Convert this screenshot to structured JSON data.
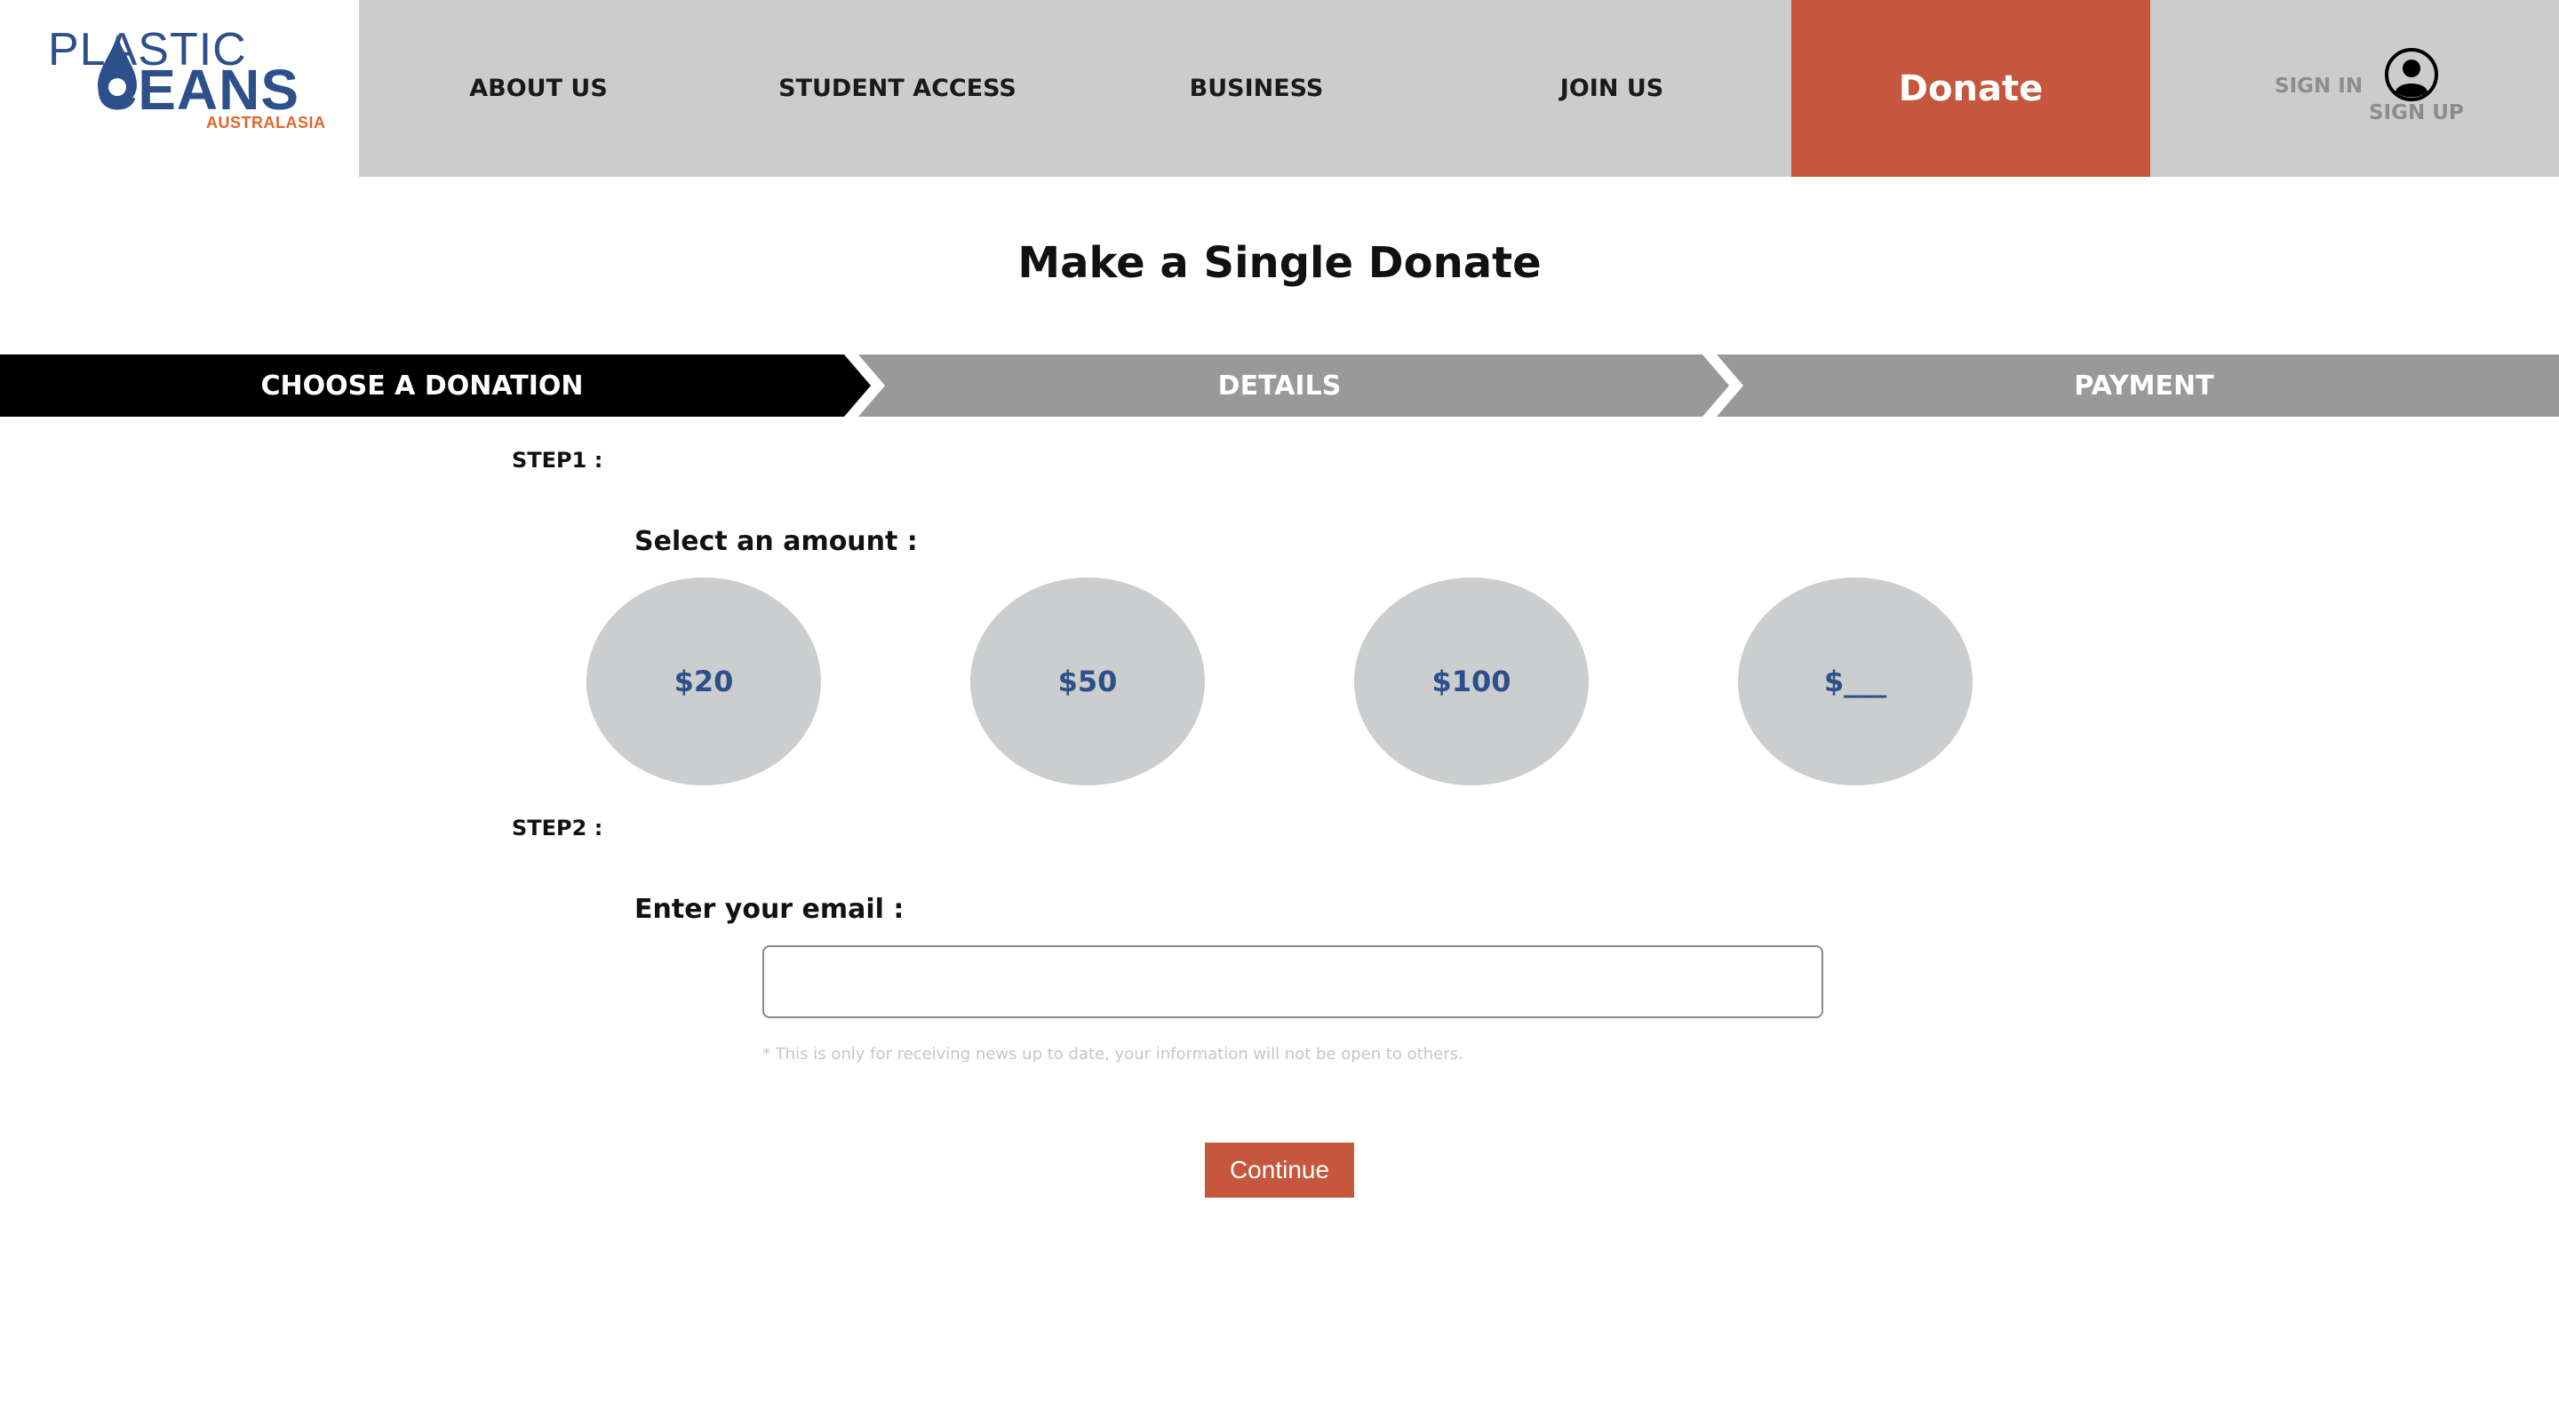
{
  "logo": {
    "line1": "PLASTIC",
    "line2": "CEANS",
    "subtitle": "AUSTRALASIA",
    "brand_color": "#2d4f8a",
    "accent_color": "#e0652e"
  },
  "nav": {
    "items": [
      {
        "label": "ABOUT US"
      },
      {
        "label": "STUDENT ACCESS"
      },
      {
        "label": "BUSINESS"
      },
      {
        "label": "JOIN US"
      }
    ],
    "donate_label": "Donate",
    "donate_color": "#c4573c",
    "sign_in": "SIGN IN",
    "sign_up": "SIGN UP",
    "user_icon": "user-circle-icon"
  },
  "page": {
    "title": "Make a Single Donate"
  },
  "steps": {
    "items": [
      {
        "label": "CHOOSE A DONATION",
        "active": true
      },
      {
        "label": "DETAILS",
        "active": false
      },
      {
        "label": "PAYMENT",
        "active": false
      }
    ],
    "active_color": "#000000",
    "inactive_color": "#999999"
  },
  "step1": {
    "heading": "STEP1 :",
    "prompt": "Select an amount :",
    "amounts": [
      "$20",
      "$50",
      "$100",
      "$___"
    ]
  },
  "step2": {
    "heading": "STEP2 :",
    "prompt": "Enter your email :",
    "email_value": "",
    "note": "* This is only for receiving news up to date, your information will not be open to others."
  },
  "continue_label": "Continue"
}
